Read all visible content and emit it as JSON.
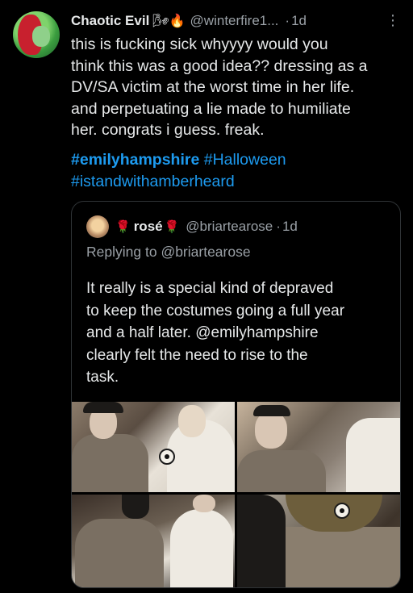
{
  "tweet": {
    "author_name": "Chaotic Evil",
    "author_emoji": "🌬🔥",
    "handle": "@winterfire1...",
    "dot": "·",
    "time": "1d",
    "more_glyph": "⋮",
    "lines": [
      "this is fucking sick whyyyy would you",
      "think this was a good idea?? dressing as a",
      "DV/SA victim at the worst time in her life.",
      "and perpetuating a lie made to humiliate",
      "her. congrats i guess. freak."
    ],
    "hashtags": [
      "#emilyhampshire",
      "#Halloween",
      "#istandwithamberheard"
    ]
  },
  "quote": {
    "rose_left": "🌹",
    "name": "rosé",
    "rose_right": "🌹",
    "handle": "@briartearose",
    "dot": "·",
    "time": "1d",
    "replying_label": "Replying to",
    "replying_handle": "@briartearose",
    "lines": [
      "It really is a special kind of depraved",
      "to keep the costumes going a full year",
      "and a half later. @emilyhampshire",
      "clearly felt the need to rise to the",
      "task."
    ]
  },
  "colors": {
    "background": "#000000",
    "text": "#e7e9ea",
    "muted": "#9aa0a6",
    "link": "#1d9bf0",
    "border": "#2f3336"
  }
}
